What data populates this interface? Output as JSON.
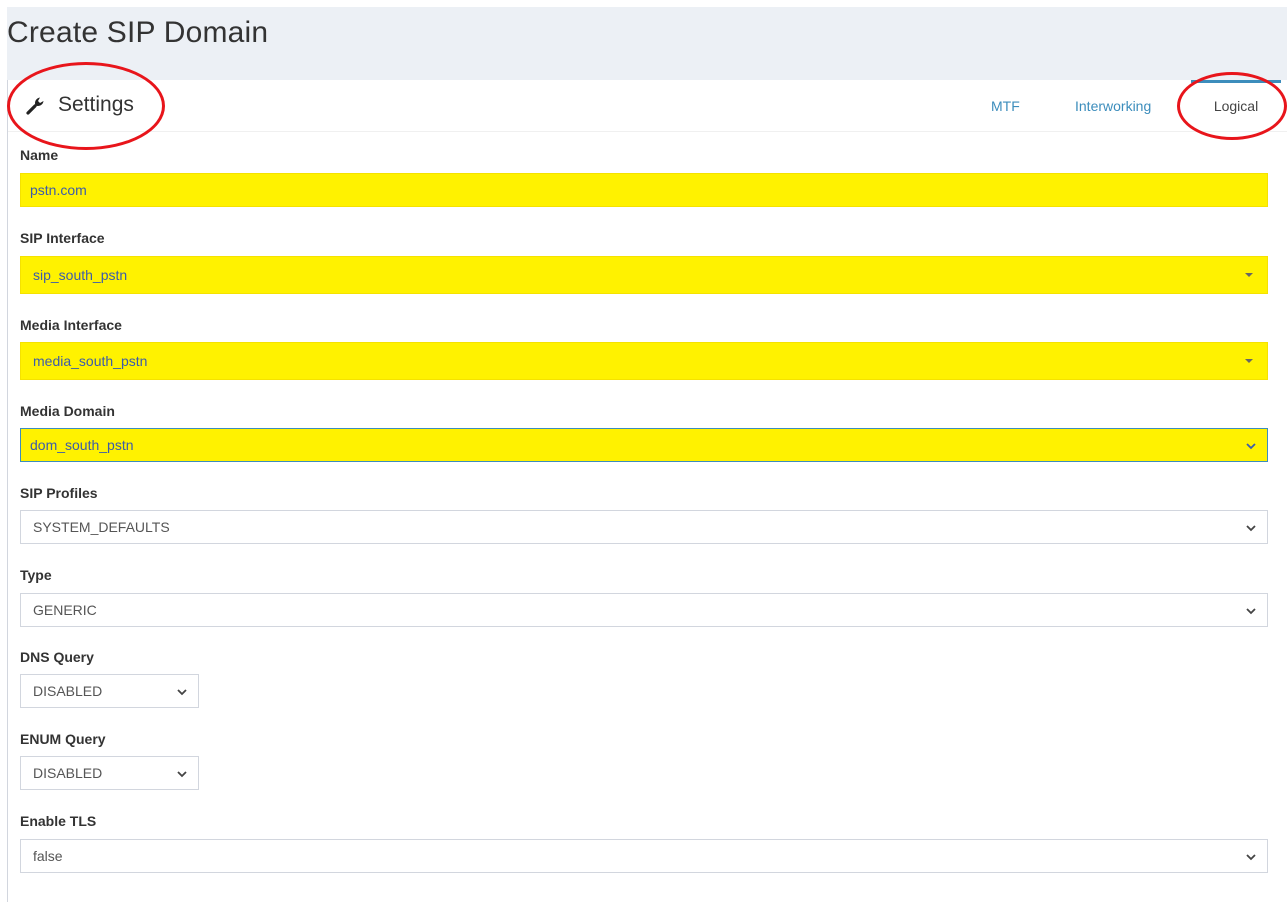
{
  "page": {
    "title": "Create SIP Domain"
  },
  "panel": {
    "title": "Settings",
    "icon": "wrench-icon",
    "tabs": [
      {
        "label": "MTF",
        "active": false
      },
      {
        "label": "Interworking",
        "active": false
      },
      {
        "label": "Logical",
        "active": true
      }
    ]
  },
  "form": {
    "name": {
      "label": "Name",
      "value": "pstn.com"
    },
    "sip_interface": {
      "label": "SIP Interface",
      "value": "sip_south_pstn"
    },
    "media_interface": {
      "label": "Media Interface",
      "value": "media_south_pstn"
    },
    "media_domain": {
      "label": "Media Domain",
      "value": "dom_south_pstn"
    },
    "sip_profiles": {
      "label": "SIP Profiles",
      "value": "SYSTEM_DEFAULTS"
    },
    "type": {
      "label": "Type",
      "value": "GENERIC"
    },
    "dns_query": {
      "label": "DNS Query",
      "value": "DISABLED"
    },
    "enum_query": {
      "label": "ENUM Query",
      "value": "DISABLED"
    },
    "enable_tls": {
      "label": "Enable TLS",
      "value": "false"
    }
  },
  "colors": {
    "highlight": "#fff200",
    "annotation_ring": "#e8151b",
    "link": "#3c8dbc"
  }
}
